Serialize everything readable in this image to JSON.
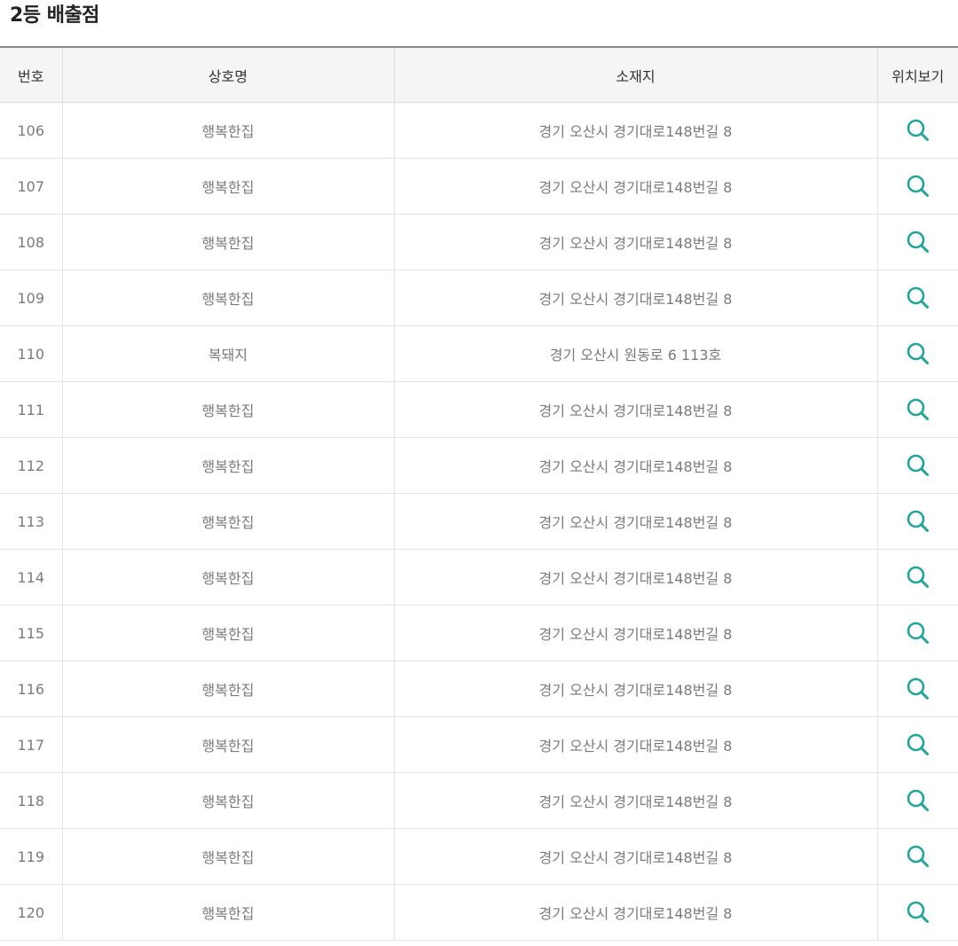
{
  "page": {
    "title": "2등 배출점"
  },
  "table": {
    "headers": [
      "번호",
      "상호명",
      "소재지",
      "위치보기"
    ],
    "rows": [
      {
        "num": "106",
        "name": "행복한집",
        "address": "경기 오산시 경기대로148번길 8"
      },
      {
        "num": "107",
        "name": "행복한집",
        "address": "경기 오산시 경기대로148번길 8"
      },
      {
        "num": "108",
        "name": "행복한집",
        "address": "경기 오산시 경기대로148번길 8"
      },
      {
        "num": "109",
        "name": "행복한집",
        "address": "경기 오산시 경기대로148번길 8"
      },
      {
        "num": "110",
        "name": "복돼지",
        "address": "경기 오산시 원동로 6 113호"
      },
      {
        "num": "111",
        "name": "행복한집",
        "address": "경기 오산시 경기대로148번길 8"
      },
      {
        "num": "112",
        "name": "행복한집",
        "address": "경기 오산시 경기대로148번길 8"
      },
      {
        "num": "113",
        "name": "행복한집",
        "address": "경기 오산시 경기대로148번길 8"
      },
      {
        "num": "114",
        "name": "행복한집",
        "address": "경기 오산시 경기대로148번길 8"
      },
      {
        "num": "115",
        "name": "행복한집",
        "address": "경기 오산시 경기대로148번길 8"
      },
      {
        "num": "116",
        "name": "행복한집",
        "address": "경기 오산시 경기대로148번길 8"
      },
      {
        "num": "117",
        "name": "행복한집",
        "address": "경기 오산시 경기대로148번길 8"
      },
      {
        "num": "118",
        "name": "행복한집",
        "address": "경기 오산시 경기대로148번길 8"
      },
      {
        "num": "119",
        "name": "행복한집",
        "address": "경기 오산시 경기대로148번길 8"
      },
      {
        "num": "120",
        "name": "행복한집",
        "address": "경기 오산시 경기대로148번길 8"
      }
    ],
    "location_icon": "search-icon"
  },
  "colors": {
    "accent": "#1fa59a",
    "header_bg": "#f5f5f5",
    "text_muted": "#7a7a7a"
  }
}
